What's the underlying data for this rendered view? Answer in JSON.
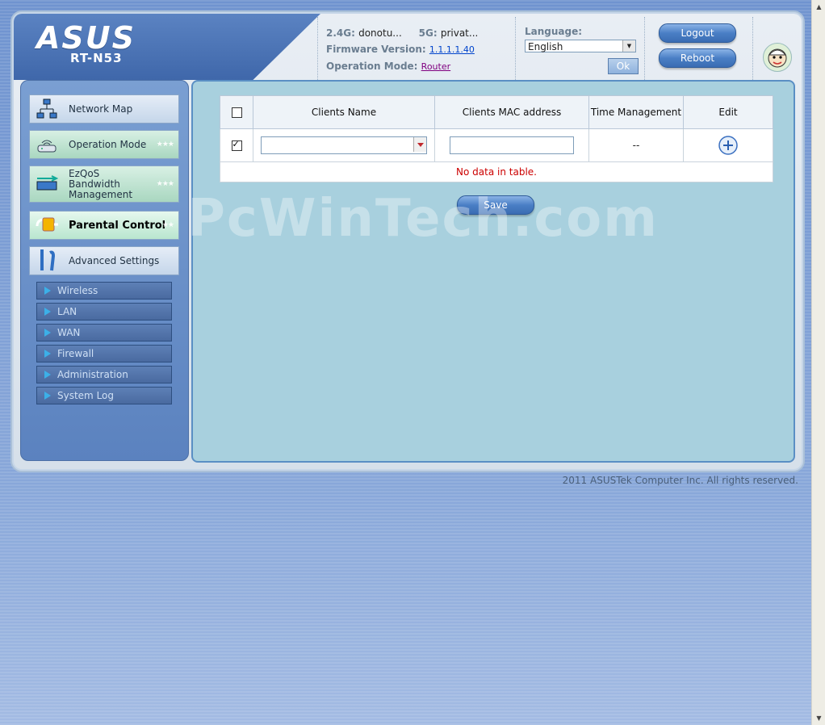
{
  "brand": {
    "logo": "ASUS",
    "model": "RT-N53"
  },
  "status": {
    "band24_label": "2.4G:",
    "band24_value": "donotu...",
    "band5_label": "5G:",
    "band5_value": "privat...",
    "firmware_label": "Firmware Version:",
    "firmware_value": "1.1.1.1.40",
    "opmode_label": "Operation Mode:",
    "opmode_value": "Router"
  },
  "language": {
    "label": "Language:",
    "selected": "English",
    "ok_label": "Ok"
  },
  "actions": {
    "logout_label": "Logout",
    "reboot_label": "Reboot"
  },
  "sidebar": {
    "items": [
      {
        "label": "Network Map",
        "icon": "network-map-icon"
      },
      {
        "label": "Operation Mode",
        "icon": "router-icon"
      },
      {
        "label": "EzQoS Bandwidth Management",
        "icon": "bandwidth-icon"
      },
      {
        "label": "Parental Control",
        "icon": "parental-control-icon"
      },
      {
        "label": "Advanced Settings",
        "icon": "tools-icon"
      }
    ],
    "sub_items": [
      "Wireless",
      "LAN",
      "WAN",
      "Firewall",
      "Administration",
      "System Log"
    ]
  },
  "table": {
    "headers": [
      "Clients Name",
      "Clients MAC address",
      "Time Management",
      "Edit"
    ],
    "time_value": "--",
    "empty_message": "No data in table."
  },
  "save_label": "Save",
  "watermark": "PcWinTech.com",
  "footer": "2011 ASUSTek Computer Inc. All rights reserved.",
  "colors": {
    "brand_blue": "#3f67aa",
    "panel_bg": "#a8d0de",
    "error_red": "#cc0000"
  }
}
